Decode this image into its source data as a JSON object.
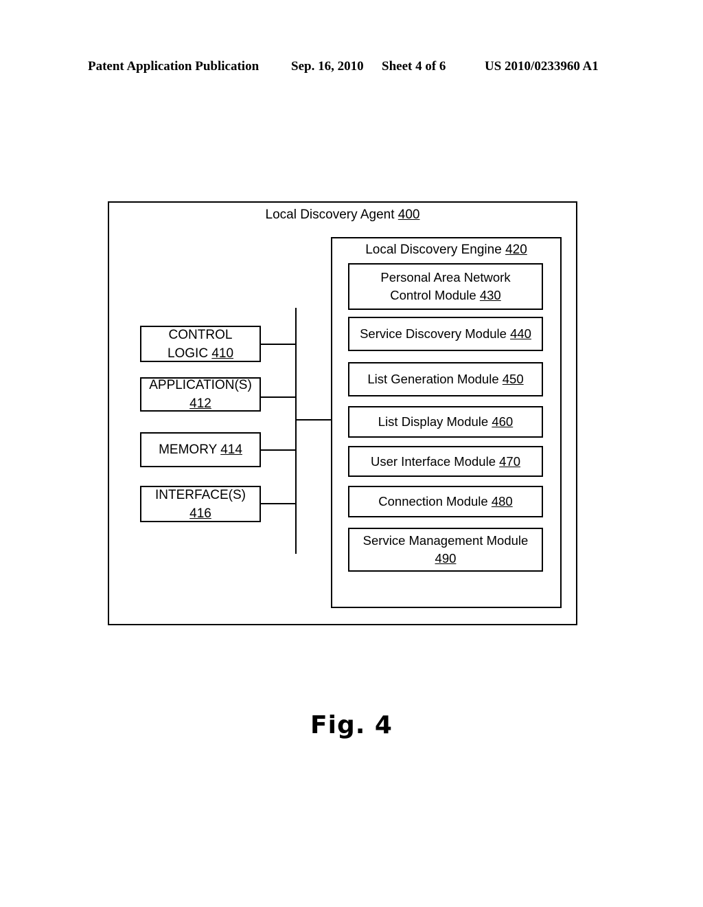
{
  "header": {
    "publication": "Patent Application Publication",
    "date": "Sep. 16, 2010",
    "sheet": "Sheet 4 of 6",
    "patent_number": "US 2010/0233960 A1"
  },
  "figure": {
    "caption": "Fig. 4",
    "outer_box": {
      "title": "Local Discovery Agent",
      "ref": "400"
    },
    "engine_box": {
      "title": "Local Discovery Engine",
      "ref": "420"
    },
    "left_components": [
      {
        "line1": "CONTROL",
        "line2": "LOGIC",
        "ref": "410",
        "inline": true
      },
      {
        "line1": "APPLICATION(S)",
        "line2": "",
        "ref": "412",
        "inline": false
      },
      {
        "line1": "MEMORY",
        "line2": "",
        "ref": "414",
        "inline": true
      },
      {
        "line1": "INTERFACE(S)",
        "line2": "",
        "ref": "416",
        "inline": false
      }
    ],
    "modules": [
      {
        "line1": "Personal Area Network",
        "line2": "Control Module",
        "ref": "430",
        "inline": true
      },
      {
        "line1": "Service Discovery Module",
        "line2": "",
        "ref": "440",
        "inline": true
      },
      {
        "line1": "List Generation Module",
        "line2": "",
        "ref": "450",
        "inline": true
      },
      {
        "line1": "List Display Module",
        "line2": "",
        "ref": "460",
        "inline": true
      },
      {
        "line1": "User Interface Module",
        "line2": "",
        "ref": "470",
        "inline": true
      },
      {
        "line1": "Connection Module",
        "line2": "",
        "ref": "480",
        "inline": true
      },
      {
        "line1": "Service Management Module",
        "line2": "",
        "ref": "490",
        "inline": false
      }
    ]
  },
  "colors": {
    "ink": "#000000",
    "paper": "#ffffff"
  }
}
